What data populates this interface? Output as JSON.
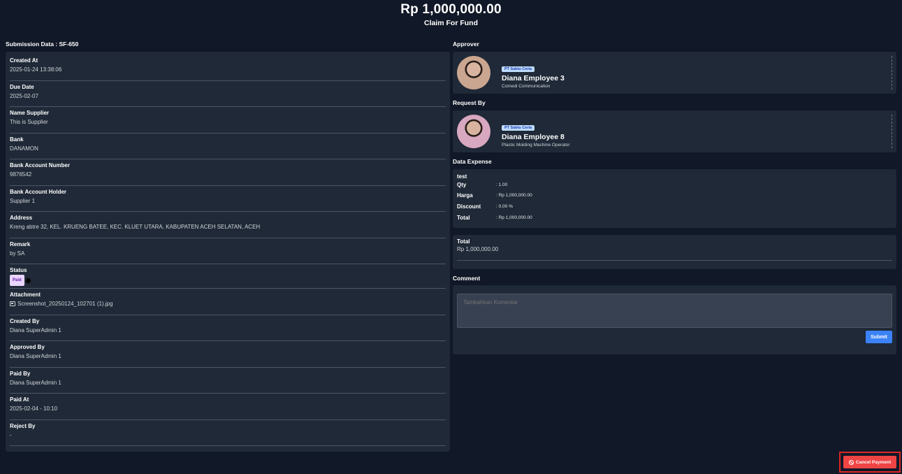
{
  "header": {
    "amount": "Rp 1,000,000.00",
    "subtitle": "Claim For Fund"
  },
  "submission_label": "Submission Data : SF-650",
  "fields": [
    {
      "label": "Created At",
      "value": "2025-01-24 13:38:06"
    },
    {
      "label": "Due Date",
      "value": "2025-02-07"
    },
    {
      "label": "Name Supplier",
      "value": "This is Supplier"
    },
    {
      "label": "Bank",
      "value": "DANAMON"
    },
    {
      "label": "Bank Account Number",
      "value": "9876542"
    },
    {
      "label": "Bank Account Holder",
      "value": "Supplier 1"
    },
    {
      "label": "Address",
      "value": "Kreng abtre 32, KEL. KRUENG BATEE, KEC. KLUET UTARA, KABUPATEN ACEH SELATAN, ACEH"
    },
    {
      "label": "Remark",
      "value": "by SA"
    }
  ],
  "status": {
    "label": "Status",
    "badge": "Paid"
  },
  "attachment": {
    "label": "Attachment",
    "file": "Screenshot_20250124_102701 (1).jpg",
    "icon": "image-icon"
  },
  "fields_after": [
    {
      "label": "Created By",
      "value": "Diana SuperAdmin 1"
    },
    {
      "label": "Approved By",
      "value": "Diana SuperAdmin 1"
    },
    {
      "label": "Paid By",
      "value": "Diana SuperAdmin 1"
    },
    {
      "label": "Paid At",
      "value": "2025-02-04 - 10:10"
    },
    {
      "label": "Reject By",
      "value": "-"
    }
  ],
  "approver": {
    "section": "Approver",
    "company": "PT Sabtu Ceria",
    "name": "Diana Employee 3",
    "role": "Comedi Communication"
  },
  "requester": {
    "section": "Request By",
    "company": "PT Sabtu Ceria",
    "name": "Diana Employee 8",
    "role": "Plastic Molding Machine Operator"
  },
  "expense": {
    "section": "Data Expense",
    "title": "test",
    "rows": [
      {
        "key": "Qty",
        "value": ": 1.00"
      },
      {
        "key": "Harga",
        "value": ": Rp 1,000,000.00"
      },
      {
        "key": "Discount",
        "value": ": 0.00 %"
      },
      {
        "key": "Total",
        "value": ": Rp 1,000,000.00"
      }
    ]
  },
  "total": {
    "label": "Total",
    "value": "Rp 1,000,000.00"
  },
  "comment": {
    "section": "Comment",
    "placeholder": "Tambahkan Komentar",
    "submit_label": "Submit"
  },
  "cancel_label": "Cancel Payment",
  "colors": {
    "background": "#111827",
    "panel": "#1f2937",
    "submit": "#3b82f6",
    "cancel": "#ef4444",
    "paid_badge": "#e9d5ff",
    "company_badge": "#bfdbfe"
  }
}
